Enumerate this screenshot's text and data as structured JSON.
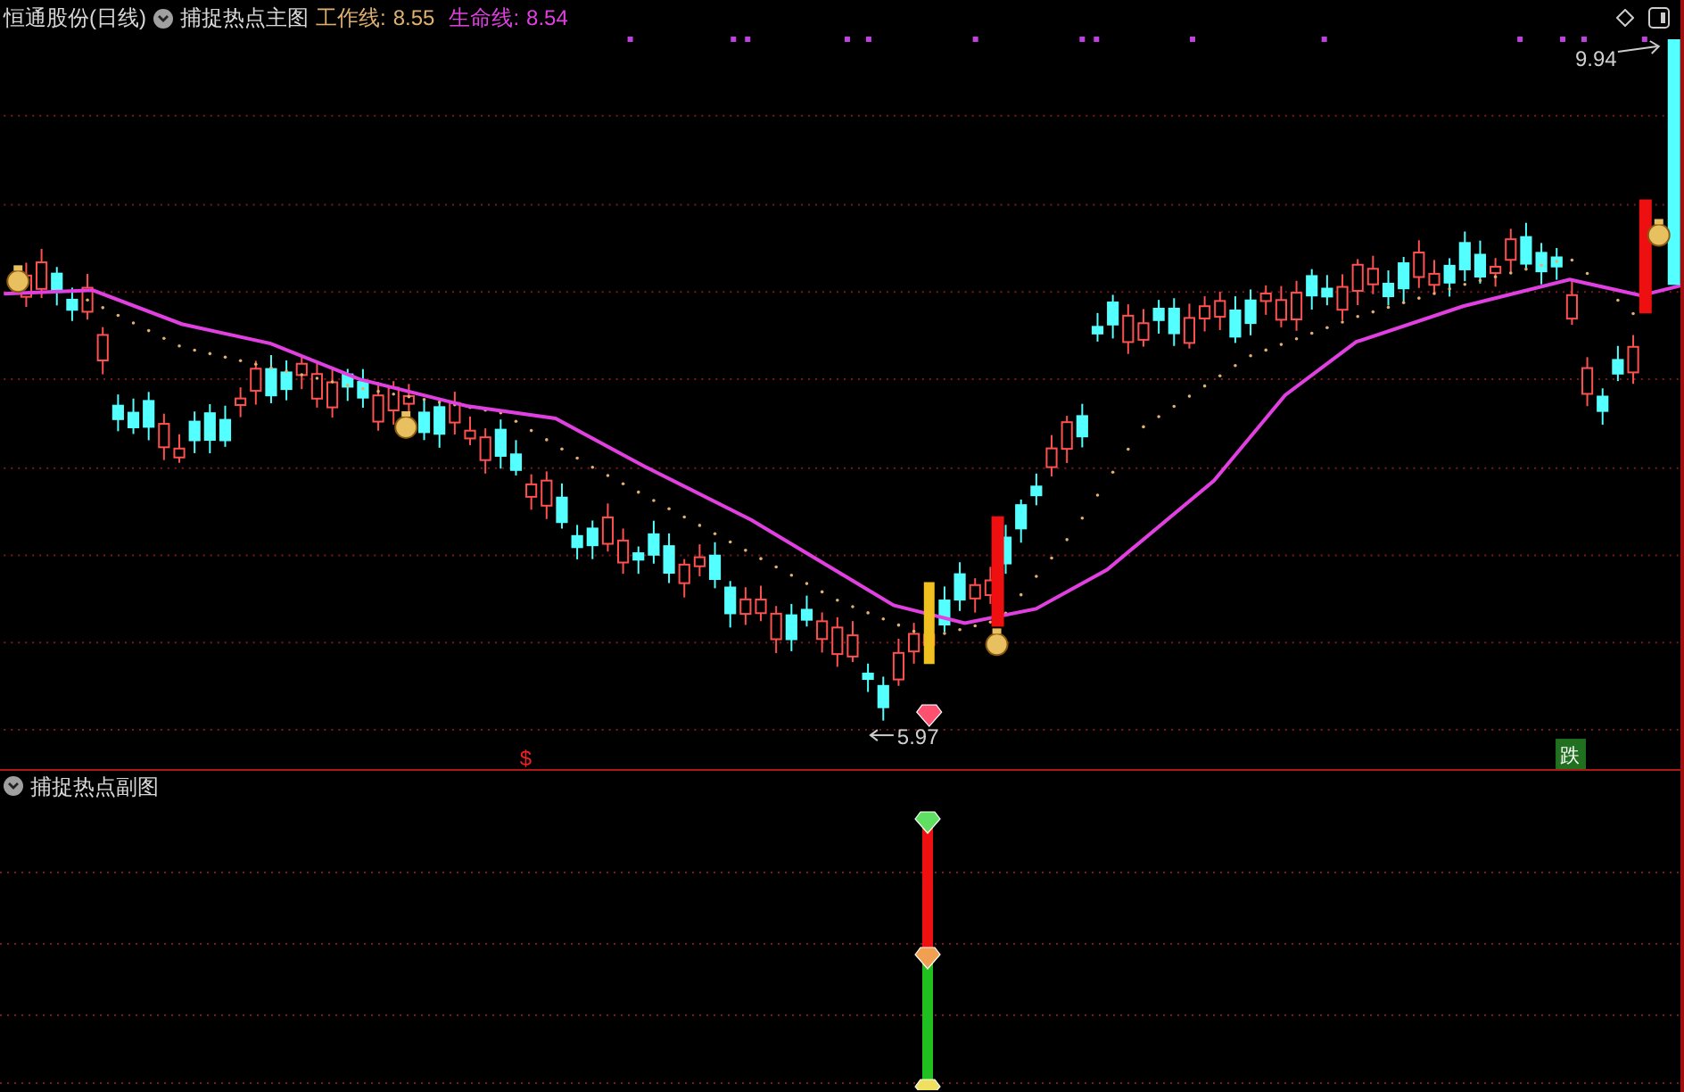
{
  "header": {
    "stock_title": "恒通股份(日线)",
    "indicator_name": "捕捉热点主图",
    "work_line": {
      "label": "工作线:",
      "value": "8.55"
    },
    "life_line": {
      "label": "生命线:",
      "value": "8.54"
    }
  },
  "main_chart": {
    "high_label": "9.94",
    "low_label": "5.97",
    "signal_mark": "$",
    "fall_badge": "跌"
  },
  "sub_chart": {
    "title": "捕捉热点副图"
  }
}
